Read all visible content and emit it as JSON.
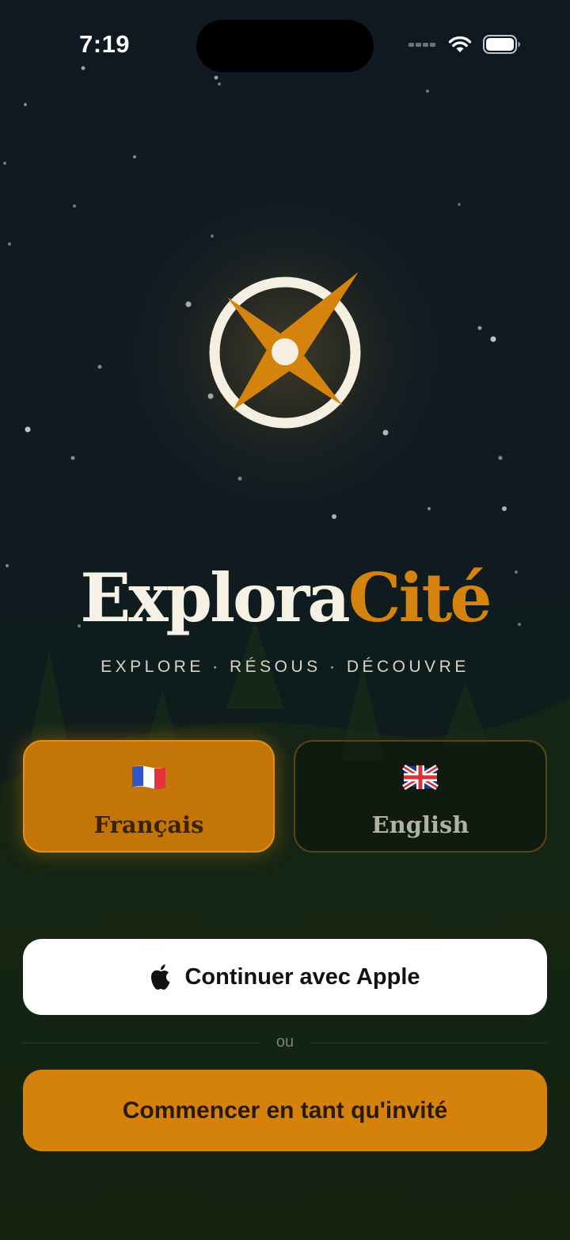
{
  "status_bar": {
    "time": "7:19",
    "icons": [
      "cellular-icon",
      "wifi-icon",
      "battery-icon"
    ]
  },
  "brand": {
    "name_part1": "Explora",
    "name_part2": "Cité",
    "tagline": "EXPLORE · RÉSOUS · DÉCOUVRE",
    "accent_color": "#d4830d",
    "light_color": "#f6f1e5",
    "logo": "compass-logo-icon"
  },
  "language_options": [
    {
      "label": "Français",
      "flag": "flag-france-icon",
      "selected": true
    },
    {
      "label": "English",
      "flag": "flag-uk-icon",
      "selected": false
    }
  ],
  "auth": {
    "apple_button": "Continuer avec Apple",
    "apple_icon": "apple-logo-icon",
    "separator": "ou",
    "guest_button": "Commencer en tant qu'invité"
  }
}
